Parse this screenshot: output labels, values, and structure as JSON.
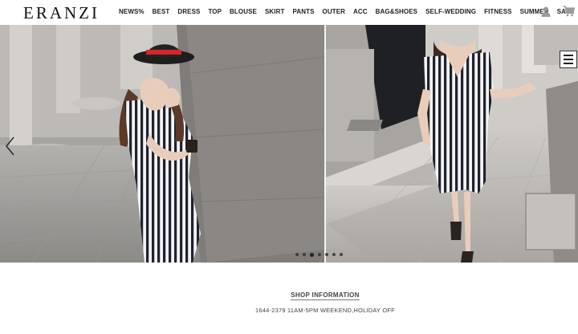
{
  "brand": {
    "logo": "ERANZI"
  },
  "nav": {
    "items": [
      "NEWS%",
      "BEST",
      "DRESS",
      "TOP",
      "BLOUSE",
      "SKIRT",
      "PANTS",
      "OUTER",
      "ACC",
      "BAG&SHOES",
      "SELF-WEDDING",
      "FITNESS",
      "SUMMER",
      "SALE"
    ]
  },
  "header_icons": {
    "user": "user-icon",
    "cart": "cart-icon"
  },
  "slider": {
    "dot_count": 7,
    "active_index": 2,
    "prev_icon": "chevron-left-icon",
    "menu_icon": "hamburger-menu-icon"
  },
  "shop_info": {
    "title": "SHOP INFORMATION",
    "line": "1644-2379  11AM-5PM  WEEKEND,HOLIDAY OFF"
  },
  "colors": {
    "text": "#222222",
    "hat_band": "#d4262c"
  }
}
